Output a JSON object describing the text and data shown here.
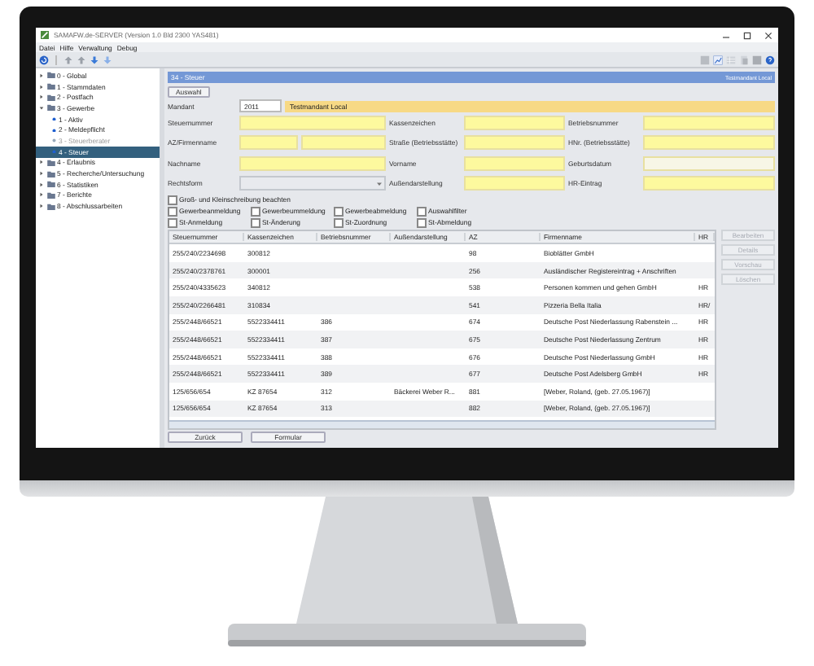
{
  "window": {
    "title": "SAMAFW.de-SERVER (Version 1.0 Bld 2300 YAS481)"
  },
  "menu": [
    "Datei",
    "Hilfe",
    "Verwaltung",
    "Debug"
  ],
  "tree": [
    {
      "label": "0 - Global",
      "expanded": false,
      "selected": false,
      "disabled": false
    },
    {
      "label": "1 - Stammdaten",
      "expanded": false,
      "selected": false,
      "disabled": false
    },
    {
      "label": "2 - Postfach",
      "expanded": false,
      "selected": false,
      "disabled": false
    },
    {
      "label": "3 - Gewerbe",
      "expanded": true,
      "selected": false,
      "disabled": false,
      "children": [
        {
          "label": "1 - Aktiv",
          "selected": false,
          "disabled": false
        },
        {
          "label": "2 - Meldepflicht",
          "selected": false,
          "disabled": false
        },
        {
          "label": "3 - Steuerberater",
          "selected": false,
          "disabled": true
        },
        {
          "label": "4 - Steuer",
          "selected": true,
          "disabled": false
        }
      ]
    },
    {
      "label": "4 - Erlaubnis",
      "expanded": false,
      "selected": false,
      "disabled": false
    },
    {
      "label": "5 - Recherche/Untersuchung",
      "expanded": false,
      "selected": false,
      "disabled": false
    },
    {
      "label": "6 - Statistiken",
      "expanded": false,
      "selected": false,
      "disabled": false
    },
    {
      "label": "7 - Berichte",
      "expanded": false,
      "selected": false,
      "disabled": false
    },
    {
      "label": "8 - Abschlussarbeiten",
      "expanded": false,
      "selected": false,
      "disabled": false
    }
  ],
  "panel": {
    "title": "34 - Steuer",
    "badge": "Testmandant Local"
  },
  "select_button": "Auswahl",
  "mandant": {
    "label": "Mandant",
    "code": "2011",
    "name": "Testmandant Local"
  },
  "form_rows": [
    [
      {
        "label": "Steuernummer",
        "kind": "text",
        "disabled": false
      },
      {
        "label": "Kassenzeichen",
        "kind": "text",
        "disabled": false
      },
      {
        "label": "Betriebsnummer",
        "kind": "text",
        "disabled": false
      }
    ],
    [
      {
        "label": "AZ/Firmenname",
        "kind": "double",
        "disabled": false
      },
      {
        "label": "Straße (Betriebsstätte)",
        "kind": "text",
        "disabled": false
      },
      {
        "label": "HNr. (Betriebsstätte)",
        "kind": "text",
        "disabled": false
      }
    ],
    [
      {
        "label": "Nachname",
        "kind": "text",
        "disabled": false
      },
      {
        "label": "Vorname",
        "kind": "text",
        "disabled": false
      },
      {
        "label": "Geburtsdatum",
        "kind": "text",
        "disabled": true
      }
    ],
    [
      {
        "label": "Rechtsform",
        "kind": "select",
        "disabled": false
      },
      {
        "label": "Außendarstellung",
        "kind": "text",
        "disabled": false
      },
      {
        "label": "HR-Eintrag",
        "kind": "text",
        "disabled": false
      }
    ]
  ],
  "checkbox_rows": [
    [
      {
        "label": "Groß- und Kleinschreibung beachten",
        "checked": false
      }
    ],
    [
      {
        "label": "Gewerbeanmeldung",
        "checked": false
      },
      {
        "label": "Gewerbeummeldung",
        "checked": false
      },
      {
        "label": "Gewerbeabmeldung",
        "checked": false
      },
      {
        "label": "Auswahlfilter",
        "checked": false
      }
    ],
    [
      {
        "label": "St-Anmeldung",
        "checked": false
      },
      {
        "label": "St-Änderung",
        "checked": false
      },
      {
        "label": "St-Zuordnung",
        "checked": false
      },
      {
        "label": "St-Abmeldung",
        "checked": false
      }
    ]
  ],
  "table": {
    "columns": [
      "Steuernummer",
      "Kassenzeichen",
      "Betriebsnummer",
      "Außendarstellung",
      "AZ",
      "Firmenname",
      "HR"
    ],
    "rows": [
      [
        "255/240/2234698",
        "300812",
        "",
        "",
        "98",
        "Bioblätter GmbH",
        ""
      ],
      [
        "255/240/2378761",
        "300001",
        "",
        "",
        "256",
        "Ausländischer Registereintrag + Anschriften",
        ""
      ],
      [
        "255/240/4335623",
        "340812",
        "",
        "",
        "538",
        "Personen kommen und gehen GmbH",
        "HR"
      ],
      [
        "255/240/2266481",
        "310834",
        "",
        "",
        "541",
        "Pizzeria Bella Italia",
        "HR/"
      ],
      [
        "255/2448/66521",
        "5522334411",
        "386",
        "",
        "674",
        "Deutsche Post Niederlassung Rabenstein ...",
        "HR"
      ],
      [
        "255/2448/66521",
        "5522334411",
        "387",
        "",
        "675",
        "Deutsche Post Niederlassung Zentrum",
        "HR"
      ],
      [
        "255/2448/66521",
        "5522334411",
        "388",
        "",
        "676",
        "Deutsche Post Niederlassung GmbH",
        "HR"
      ],
      [
        "255/2448/66521",
        "5522334411",
        "389",
        "",
        "677",
        "Deutsche Post Adelsberg GmbH",
        "HR"
      ],
      [
        "125/656/654",
        "KZ 87654",
        "312",
        "Bäckerei Weber R...",
        "881",
        "[Weber, Roland, (geb. 27.05.1967)]",
        ""
      ],
      [
        "125/656/654",
        "KZ 87654",
        "313",
        "",
        "882",
        "[Weber, Roland, (geb. 27.05.1967)]",
        ""
      ]
    ]
  },
  "side_buttons": [
    {
      "label": "Bearbeiten",
      "disabled": true
    },
    {
      "label": "Details",
      "disabled": true
    },
    {
      "label": "Vorschau",
      "disabled": true
    },
    {
      "label": "Löschen",
      "disabled": true
    }
  ],
  "bottom_buttons": [
    "Zurück",
    "Formular"
  ]
}
